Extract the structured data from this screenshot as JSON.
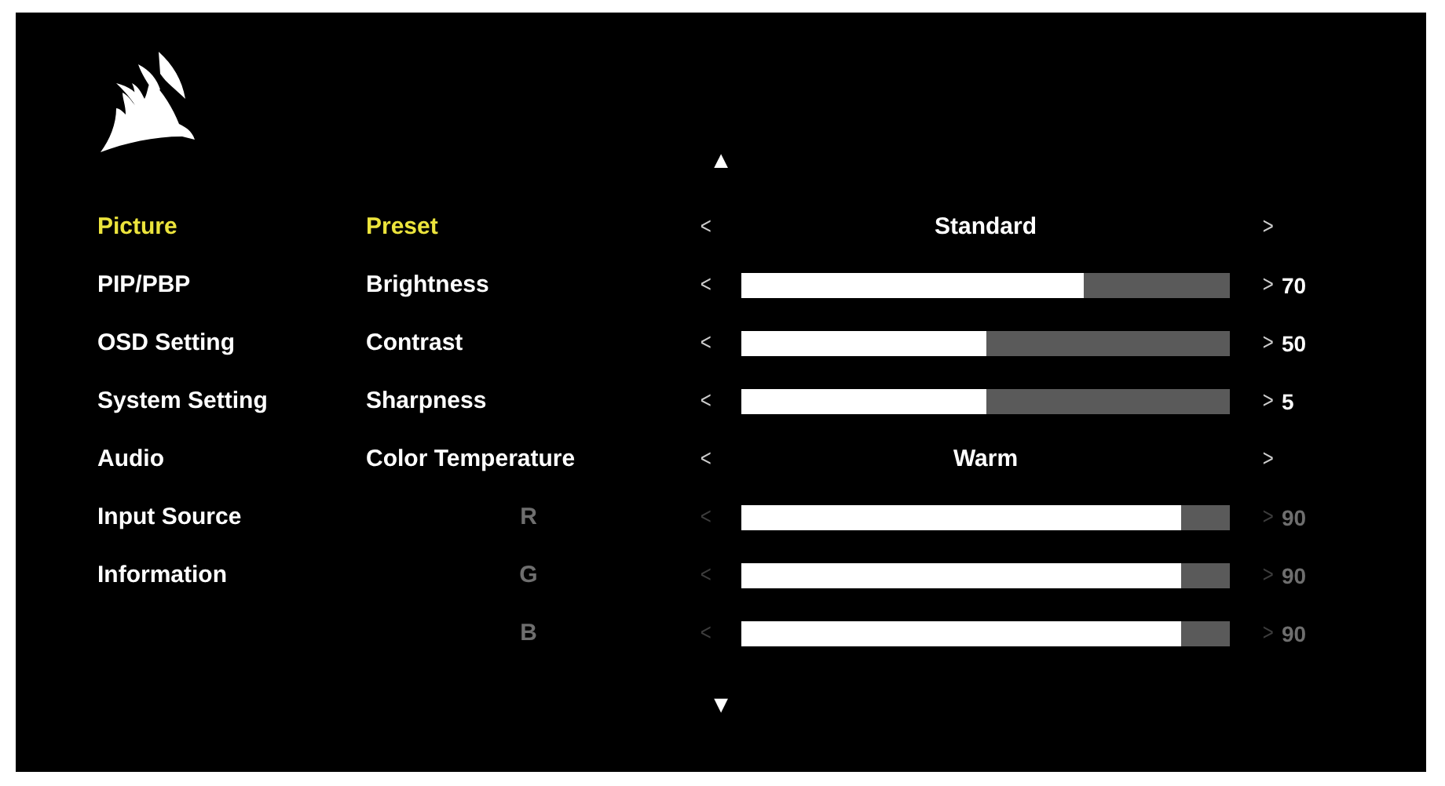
{
  "menu": [
    {
      "label": "Picture",
      "selected": true
    },
    {
      "label": "PIP/PBP",
      "selected": false
    },
    {
      "label": "OSD Setting",
      "selected": false
    },
    {
      "label": "System Setting",
      "selected": false
    },
    {
      "label": "Audio",
      "selected": false
    },
    {
      "label": "Input Source",
      "selected": false
    },
    {
      "label": "Information",
      "selected": false
    }
  ],
  "scroll_up": "▲",
  "scroll_down": "▼",
  "settings": [
    {
      "kind": "choice",
      "label": "Preset",
      "selected": true,
      "disabled": false,
      "prev": "<",
      "next": ">",
      "value": "Standard"
    },
    {
      "kind": "slider",
      "label": "Brightness",
      "selected": false,
      "disabled": false,
      "prev": "<",
      "next": ">",
      "level": 0.7,
      "reading": "70"
    },
    {
      "kind": "slider",
      "label": "Contrast",
      "selected": false,
      "disabled": false,
      "prev": "<",
      "next": ">",
      "level": 0.5,
      "reading": "50"
    },
    {
      "kind": "slider",
      "label": "Sharpness",
      "selected": false,
      "disabled": false,
      "prev": "<",
      "next": ">",
      "level": 0.5,
      "reading": "5"
    },
    {
      "kind": "choice",
      "label": "Color Temperature",
      "selected": false,
      "disabled": false,
      "prev": "<",
      "next": ">",
      "value": "Warm"
    },
    {
      "kind": "channel",
      "label": "R",
      "selected": false,
      "disabled": true,
      "prev": "<",
      "next": ">",
      "level": 0.9,
      "reading": "90"
    },
    {
      "kind": "channel",
      "label": "G",
      "selected": false,
      "disabled": true,
      "prev": "<",
      "next": ">",
      "level": 0.9,
      "reading": "90"
    },
    {
      "kind": "channel",
      "label": "B",
      "selected": false,
      "disabled": true,
      "prev": "<",
      "next": ">",
      "level": 0.9,
      "reading": "90"
    }
  ]
}
